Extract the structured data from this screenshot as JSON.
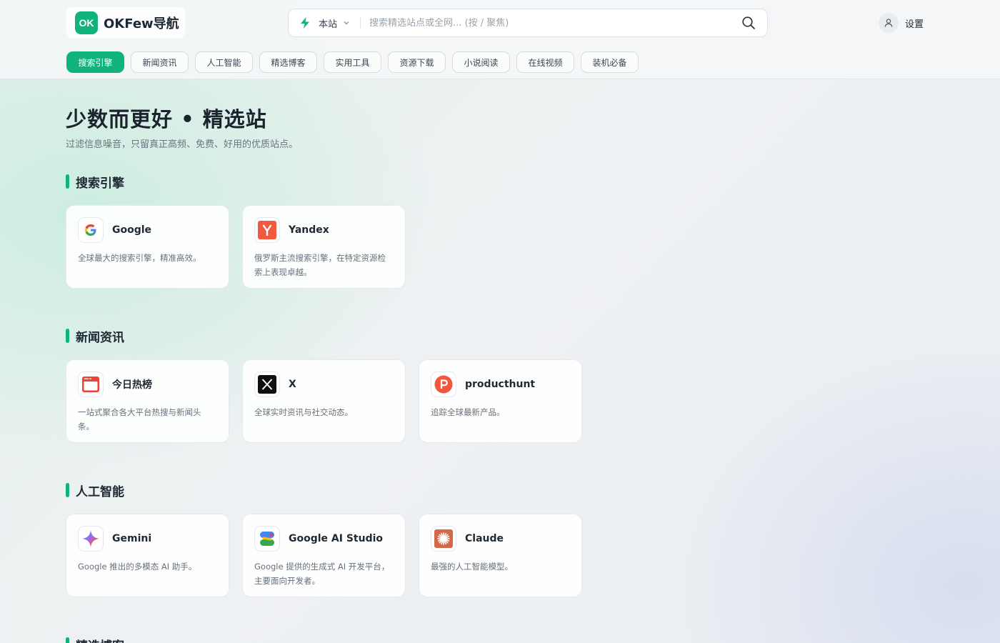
{
  "header": {
    "logo_badge": "OK",
    "logo_text": "OKFew导航",
    "search": {
      "scope_label": "本站",
      "placeholder": "搜索精选站点或全网... (按 / 聚焦)"
    },
    "settings_label": "设置"
  },
  "tabs": [
    {
      "label": "搜索引擎",
      "active": true
    },
    {
      "label": "新闻资讯"
    },
    {
      "label": "人工智能"
    },
    {
      "label": "精选博客"
    },
    {
      "label": "实用工具"
    },
    {
      "label": "资源下载"
    },
    {
      "label": "小说阅读"
    },
    {
      "label": "在线视频"
    },
    {
      "label": "装机必备"
    }
  ],
  "hero": {
    "title": "少数而更好 • 精选站",
    "subtitle": "过滤信息噪音，只留真正高频、免费、好用的优质站点。"
  },
  "sections": [
    {
      "title": "搜索引擎",
      "cards": [
        {
          "name": "Google",
          "icon": "google-icon",
          "desc": "全球最大的搜索引擎，精准高效。"
        },
        {
          "name": "Yandex",
          "icon": "yandex-icon",
          "desc": "俄罗斯主流搜索引擎，在特定资源检索上表现卓越。"
        }
      ]
    },
    {
      "title": "新闻资讯",
      "cards": [
        {
          "name": "今日热榜",
          "icon": "tophub-icon",
          "desc": "一站式聚合各大平台热搜与新闻头条。"
        },
        {
          "name": "X",
          "icon": "x-icon",
          "desc": "全球实时资讯与社交动态。"
        },
        {
          "name": "producthunt",
          "icon": "producthunt-icon",
          "desc": "追踪全球最新产品。"
        }
      ]
    },
    {
      "title": "人工智能",
      "cards": [
        {
          "name": "Gemini",
          "icon": "gemini-icon",
          "desc": "Google 推出的多模态 AI 助手。"
        },
        {
          "name": "Google AI Studio",
          "icon": "ai-studio-icon",
          "desc": "Google 提供的生成式 AI 开发平台，主要面向开发者。"
        },
        {
          "name": "Claude",
          "icon": "claude-icon",
          "desc": "最强的人工智能模型。"
        }
      ]
    },
    {
      "title": "精选博客",
      "cards": []
    }
  ],
  "colors": {
    "accent": "#10b37a",
    "text": "#1f2933",
    "muted": "#66707b"
  }
}
